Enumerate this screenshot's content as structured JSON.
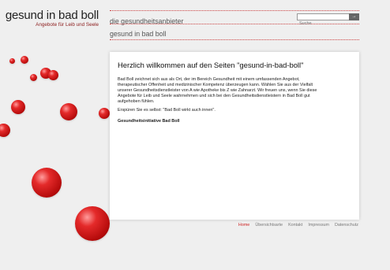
{
  "brand": {
    "title": "gesund in bad boll",
    "subtitle": "Angebote für Leib und Seele"
  },
  "header": {
    "nav_label": "die gesundheitsanbieter",
    "search_placeholder": "Suche"
  },
  "section_title": "gesund in bad boll",
  "content": {
    "heading": "Herzlich willkommen auf den Seiten \"gesund-in-bad-boll\"",
    "paragraph1": "Bad Boll zeichnet sich aus als Ort, der im Bereich Gesundheit mit einem umfassenden Angebot, therapeutischer Offenheit und medizinischer Kompetenz überzeugen kann. Wählen Sie aus der Vielfalt unserer Gesundheitsdienstleister von A wie Apotheke bis Z wie Zahnarzt. Wir freuen uns, wenn Sie diese Angebote für Leib und Seele wahrnehmen und sich bei den Gesundheitsdienstleistern in Bad Boll gut aufgehoben fühlen.",
    "paragraph2": "Erspüren Sie es selbst: \"Bad Boll wirkt auch innen\".",
    "signature": "Gesundheitsinitiative Bad Boll"
  },
  "footer": {
    "links": [
      "Home",
      "Übersichtsarte",
      "Kontakt",
      "Impressum",
      "Datenschutz"
    ]
  },
  "colors": {
    "accent": "#cc2222",
    "background": "#efefef"
  }
}
